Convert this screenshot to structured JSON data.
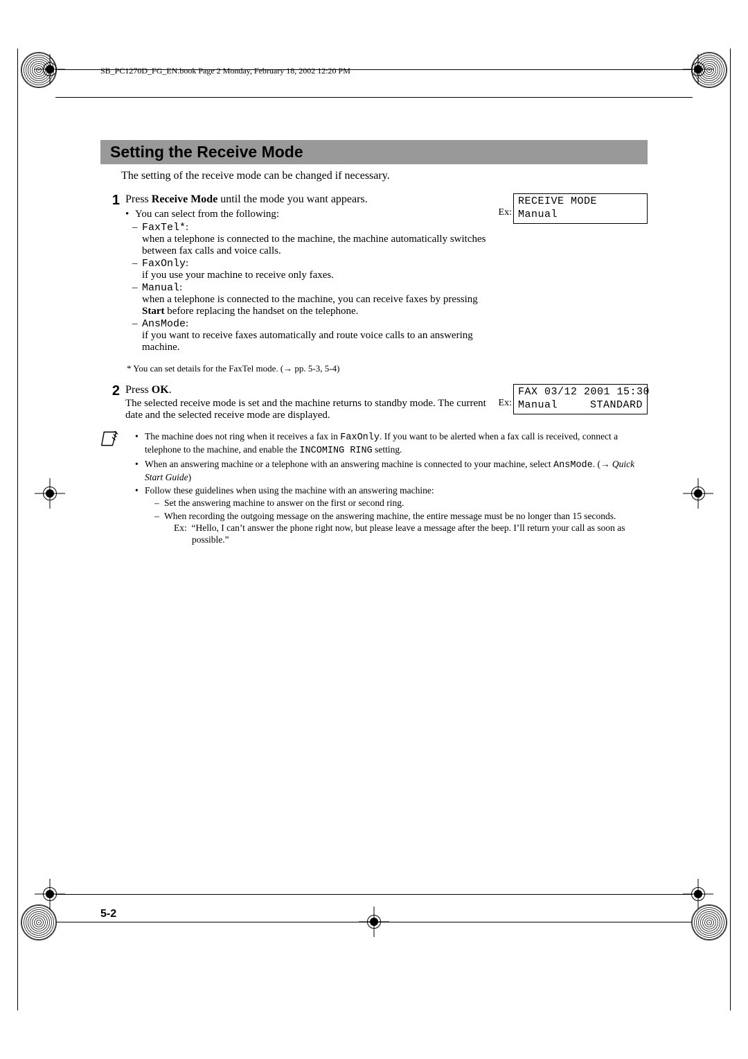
{
  "running_head": "SB_PC1270D_FG_EN.book  Page 2  Monday, February 18, 2002  12:20 PM",
  "heading": "Setting the Receive Mode",
  "intro": "The setting of the receive mode can be changed if necessary.",
  "step1": {
    "num": "1",
    "line_a": "Press ",
    "line_b": "Receive Mode",
    "line_c": " until the mode you want appears.",
    "bullet": "You can select from the following:",
    "modes": {
      "faxtel_label": "FaxTel*",
      "faxtel_desc": "when a telephone is connected to the machine, the machine automatically switches between fax calls and voice calls.",
      "faxonly_label": "FaxOnly",
      "faxonly_desc": "if you use your machine to receive only faxes.",
      "manual_label": "Manual",
      "manual_desc_a": "when a telephone is connected to the machine, you can receive faxes by pressing ",
      "manual_desc_b": "Start",
      "manual_desc_c": " before replacing the handset on the telephone.",
      "ansmode_label": "AnsMode",
      "ansmode_desc": "if you want to receive faxes automatically and route voice calls to an answering machine."
    },
    "footnote": "*   You can set details for the FaxTel mode. (→ pp. 5-3, 5-4)",
    "ex_label": "Ex:",
    "lcd_line1": "RECEIVE MODE",
    "lcd_line2": "Manual"
  },
  "step2": {
    "num": "2",
    "line_a": "Press ",
    "line_b": "OK",
    "line_c": ".",
    "body": "The selected receive mode is set and the machine returns to standby mode. The current date and the selected receive mode are displayed.",
    "ex_label": "Ex:",
    "lcd_line1": "FAX 03/12 2001 15:30",
    "lcd_line2_left": "Manual",
    "lcd_line2_right": "STANDARD"
  },
  "notes": {
    "n1_a": "The machine does not ring when it receives a fax in ",
    "n1_b": "FaxOnly",
    "n1_c": ". If you want to be alerted when a fax call is received, connect a telephone to the machine, and enable the ",
    "n1_d": "INCOMING RING",
    "n1_e": " setting.",
    "n2_a": "When an answering machine or a telephone with an answering machine is connected to your machine, select ",
    "n2_b": "AnsMode",
    "n2_c": ". (→ ",
    "n2_d": "Quick Start Guide",
    "n2_e": ")",
    "n3": "Follow these guidelines when using the machine with an answering machine:",
    "n3s1": "Set the answering machine to answer on the first or second ring.",
    "n3s2": "When recording the outgoing message on the answering machine, the entire message must be no longer than 15 seconds.",
    "n3ex_label": "Ex:",
    "n3ex_a": "“Hello, I can’t answer the phone right now, but please leave a message after the beep. I’ll return your call as soon as possible.”"
  },
  "page_num": "5-2"
}
